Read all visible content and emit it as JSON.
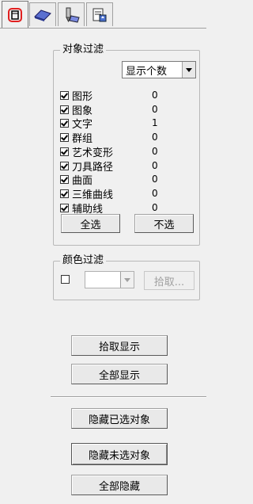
{
  "tabs": [
    {
      "icon": "object-select-icon",
      "active": true
    },
    {
      "icon": "surface-icon",
      "active": false
    },
    {
      "icon": "tool-icon",
      "active": false
    },
    {
      "icon": "export-icon",
      "active": false
    }
  ],
  "object_filter": {
    "title": "对象过滤",
    "display_select": "显示个数",
    "items": [
      {
        "label": "图形",
        "checked": true,
        "count": "0"
      },
      {
        "label": "图象",
        "checked": true,
        "count": "0"
      },
      {
        "label": "文字",
        "checked": true,
        "count": "1"
      },
      {
        "label": "群组",
        "checked": true,
        "count": "0"
      },
      {
        "label": "艺术变形",
        "checked": true,
        "count": "0"
      },
      {
        "label": "刀具路径",
        "checked": true,
        "count": "0"
      },
      {
        "label": "曲面",
        "checked": true,
        "count": "0"
      },
      {
        "label": "三维曲线",
        "checked": true,
        "count": "0"
      },
      {
        "label": "辅助线",
        "checked": true,
        "count": "0"
      }
    ],
    "select_all": "全选",
    "select_none": "不选"
  },
  "color_filter": {
    "title": "颜色过滤",
    "checked": false,
    "pick_label": "拾取..."
  },
  "actions": {
    "pick_show": "拾取显示",
    "show_all": "全部显示",
    "hide_selected": "隐藏已选对象",
    "hide_unselected": "隐藏未选对象",
    "hide_all": "全部隐藏"
  },
  "colors": {
    "active_tab_icon": "#e02020",
    "panel_bg": "#f0f0f0"
  }
}
